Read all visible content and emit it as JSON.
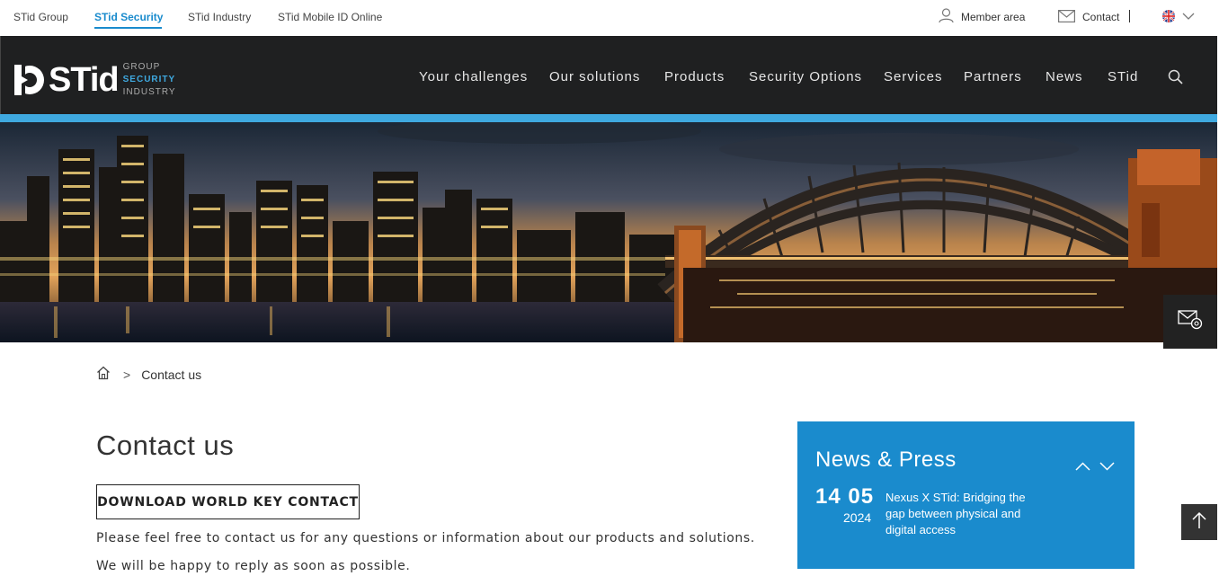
{
  "topbar": {
    "group_links": [
      {
        "label": "STid Group",
        "active": false
      },
      {
        "label": "STid Security",
        "active": true
      },
      {
        "label": "STid Industry",
        "active": false
      },
      {
        "label": "STid Mobile ID Online",
        "active": false
      }
    ],
    "member_area": "Member area",
    "member_icon": "user-icon",
    "contact": "Contact",
    "contact_icon": "envelope-icon",
    "language_icon": "uk-flag-icon"
  },
  "logo": {
    "text": "STid",
    "lines": [
      "GROUP",
      "SECURITY",
      "INDUSTRY"
    ]
  },
  "nav": {
    "items": [
      "Your challenges",
      "Our solutions",
      "Products",
      "Security Options",
      "Services",
      "Partners",
      "News",
      "STid"
    ],
    "search_icon": "search-icon"
  },
  "breadcrumb": {
    "home_icon": "home-icon",
    "separator": ">",
    "current": "Contact us"
  },
  "main": {
    "title": "Contact us",
    "download_label": "DOWNLOAD WORLD KEY CONTACT",
    "paragraphs": [
      "Please feel free to contact us for any questions or information about our products and solutions.",
      "We will be happy to reply as soon as possible."
    ]
  },
  "news": {
    "title": "News & Press",
    "item": {
      "day_month": "14 05",
      "year": "2024",
      "text": "Nexus X STid: Bridging the gap between physical and digital access"
    }
  },
  "colors": {
    "accent": "#1a8bcd",
    "header_bg": "#1f2021",
    "strip": "#3fa9e0"
  }
}
